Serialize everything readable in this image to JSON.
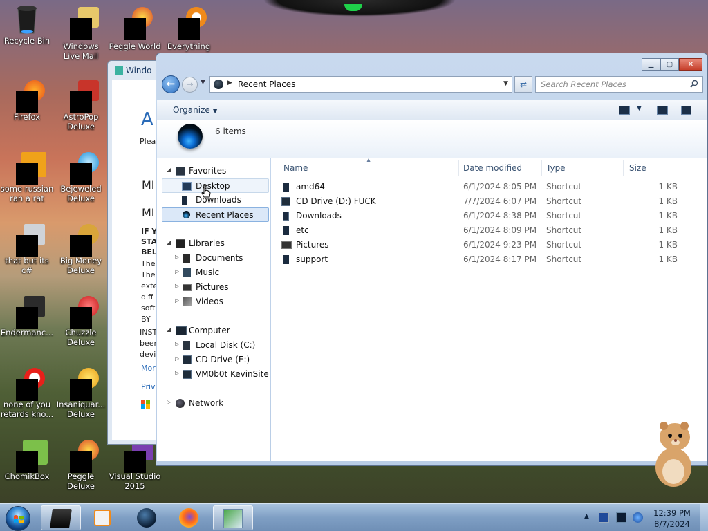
{
  "desktop": {
    "icons": [
      {
        "label": "Recycle Bin"
      },
      {
        "label": "Windows Live Mail"
      },
      {
        "label": "Peggle World of Warcraft"
      },
      {
        "label": "Everything"
      },
      {
        "label": "Firefox"
      },
      {
        "label": "AstroPop Deluxe"
      },
      {
        "label": "some russian ran a rat"
      },
      {
        "label": "Bejeweled Deluxe"
      },
      {
        "label": "that but its c#"
      },
      {
        "label": "Big Money Deluxe"
      },
      {
        "label": "Endermanc..."
      },
      {
        "label": "Chuzzle Deluxe"
      },
      {
        "label": "none of you retards kno..."
      },
      {
        "label": "Insaniquar... Deluxe"
      },
      {
        "label": "ChomikBox"
      },
      {
        "label": "Peggle Deluxe"
      },
      {
        "label": "Visual Studio 2015"
      }
    ]
  },
  "back_window": {
    "title": "Windo",
    "lines": [
      "A",
      "Plea",
      "MI",
      "MI",
      "IF Y",
      "STA",
      "BEL",
      "The",
      "The",
      "exte",
      "diff",
      "soft",
      "BY",
      "INST",
      "been",
      "devi",
      "Mor",
      "Priv"
    ]
  },
  "explorer": {
    "address": {
      "location": "Recent Places"
    },
    "search": {
      "placeholder": "Search Recent Places"
    },
    "toolbar": {
      "organize_label": "Organize"
    },
    "details": {
      "item_count": "6 items"
    },
    "nav": {
      "favorites": "Favorites",
      "desktop": "Desktop",
      "downloads": "Downloads",
      "recent_places": "Recent Places",
      "libraries": "Libraries",
      "documents": "Documents",
      "music": "Music",
      "pictures": "Pictures",
      "videos": "Videos",
      "computer": "Computer",
      "local_disk": "Local Disk (C:)",
      "cd_drive": "CD Drive (E:)",
      "vm_share": "VM0b0t KevinSite",
      "network": "Network"
    },
    "columns": {
      "name": "Name",
      "date_modified": "Date modified",
      "type": "Type",
      "size": "Size"
    },
    "files": [
      {
        "name": "amd64",
        "date": "6/1/2024 8:05 PM",
        "type": "Shortcut",
        "size": "1 KB"
      },
      {
        "name": "CD Drive (D:) FUCK",
        "date": "7/7/2024 6:07 PM",
        "type": "Shortcut",
        "size": "1 KB"
      },
      {
        "name": "Downloads",
        "date": "6/1/2024 8:38 PM",
        "type": "Shortcut",
        "size": "1 KB"
      },
      {
        "name": "etc",
        "date": "6/1/2024 8:09 PM",
        "type": "Shortcut",
        "size": "1 KB"
      },
      {
        "name": "Pictures",
        "date": "6/1/2024 9:23 PM",
        "type": "Shortcut",
        "size": "1 KB"
      },
      {
        "name": "support",
        "date": "6/1/2024 8:17 PM",
        "type": "Shortcut",
        "size": "1 KB"
      }
    ]
  },
  "taskbar": {
    "clock_time": "12:39 PM",
    "clock_date": "8/7/2024"
  },
  "colors": {
    "accent": "#3b6ea8",
    "selection": "#dbe8f8",
    "close_button": "#c7402c"
  }
}
